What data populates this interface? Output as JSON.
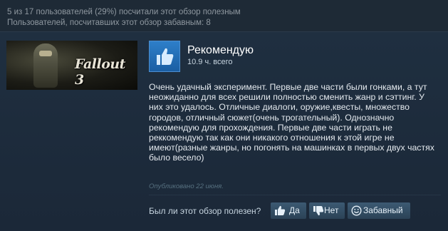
{
  "stats": {
    "helpful_line": "5 из 17 пользователей (29%) посчитали этот обзор полезным",
    "funny_line": "Пользователей, посчитавших этот обзор забавным: 8"
  },
  "game": {
    "logo_text": "Fallout 3"
  },
  "review": {
    "verdict": "Рекомендую",
    "hours": "10.9 ч. всего",
    "body": "Очень удачный эксперимент. Первые две части были гонками, а тут неожиданно для всех решили полностью сменить жанр и сэттинг. У них это удалось. Отличные диалоги, оружие,квесты, множество городов, отличный сюжет(очень трогательный). Однозначно рекомендую для прохождения. Первые две части играть не реккомендую так как они никакого отношения к этой игре не имеют(разные жанры, но погонять на машинках в первых двух частях было весело)",
    "posted": "Опубликовано 22 июня."
  },
  "feedback": {
    "question": "Был ли этот обзор полезен?",
    "yes_label": "Да",
    "no_label": "Нет",
    "funny_label": "Забавный"
  },
  "icons": {
    "recommend": "thumbs-up-icon",
    "yes": "thumbs-up-icon",
    "no": "thumbs-down-icon",
    "funny": "smiley-icon"
  },
  "colors": {
    "background": "#1b2838",
    "accent_blue": "#2e7fc9",
    "button": "#3c5a73"
  }
}
